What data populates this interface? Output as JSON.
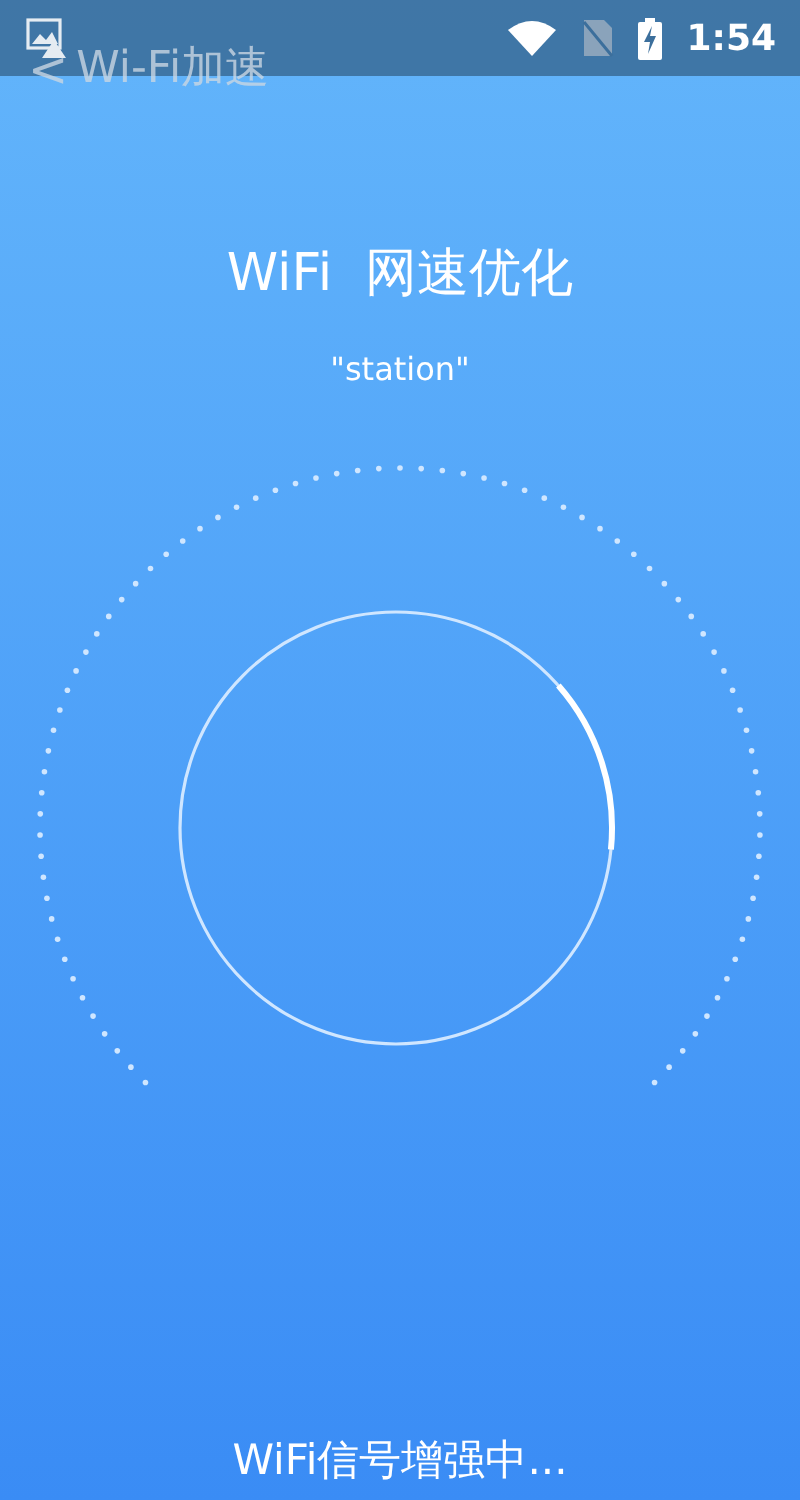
{
  "status_bar": {
    "time": "1:54"
  },
  "title_bar": {
    "back": "<",
    "title": "Wi-Fi加速"
  },
  "heading": "WiFi  网速优化",
  "network_name": "\"station\"",
  "status_text": "WiFi信号增强中..."
}
